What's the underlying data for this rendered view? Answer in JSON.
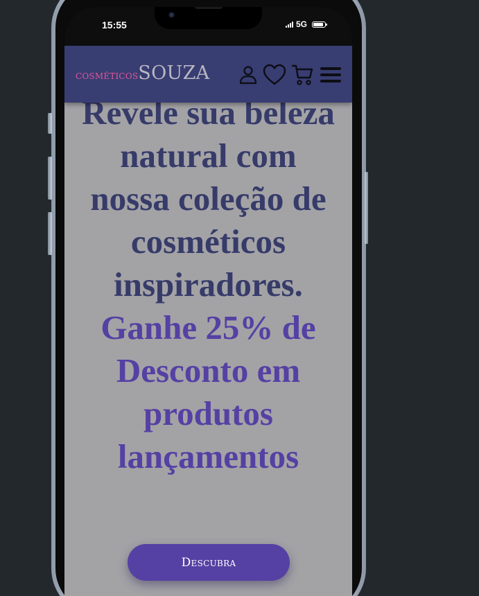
{
  "status_bar": {
    "time": "15:55",
    "network": "5G"
  },
  "header": {
    "logo_small": "cosméticos",
    "logo_big": "SOUZA",
    "icons": [
      "user-icon",
      "heart-icon",
      "cart-icon",
      "menu-icon"
    ]
  },
  "hero": {
    "headline": "Revele sua beleza natural com nossa coleção de cosméticos inspiradores.",
    "promo": "Ganhe 25% de Desconto em produtos lançamentos",
    "cta_label": "Descubra"
  },
  "colors": {
    "header_bg": "#383d72",
    "logo_accent": "#e0589c",
    "headline": "#363b69",
    "promo": "#5540a3",
    "page_bg": "#a3a3a6"
  }
}
